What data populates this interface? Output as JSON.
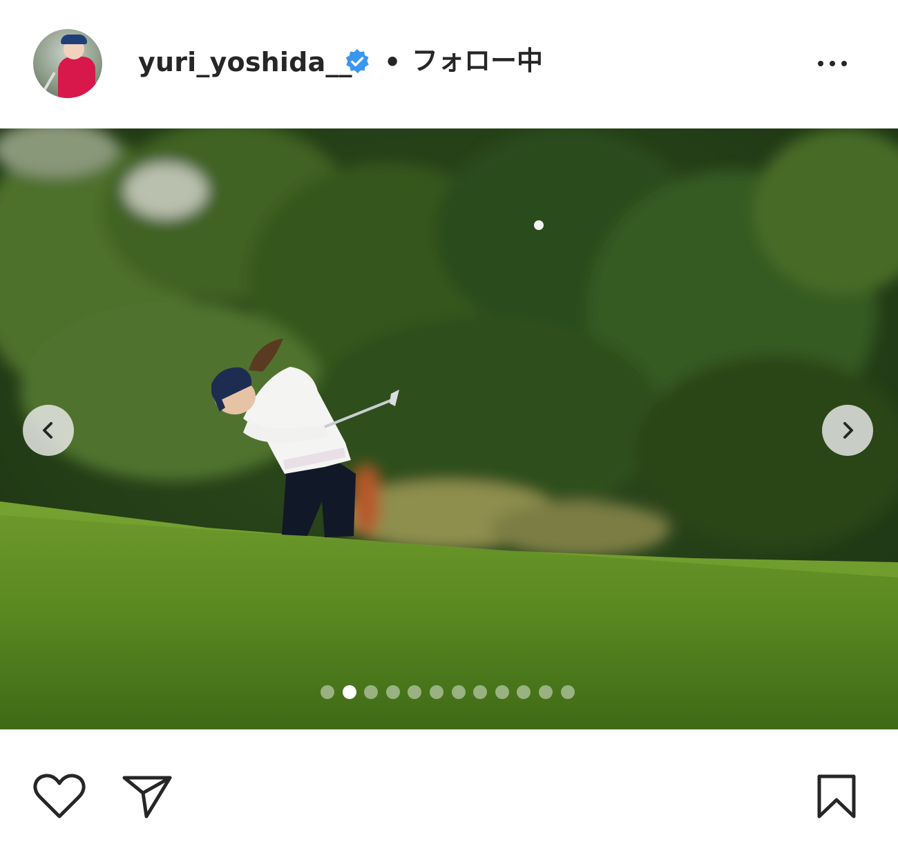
{
  "post": {
    "username": "yuri_yoshida__",
    "verified": true,
    "separator": "•",
    "follow_status": "フォロー中",
    "more_icon": "more-horizontal-icon"
  },
  "carousel": {
    "total_slides": 12,
    "current_slide": 2,
    "prev_icon": "chevron-left-icon",
    "next_icon": "chevron-right-icon"
  },
  "actions": {
    "like_icon": "heart-icon",
    "share_icon": "paper-plane-icon",
    "save_icon": "bookmark-icon"
  },
  "colors": {
    "verified_blue": "#3897f0",
    "text": "#262626"
  }
}
